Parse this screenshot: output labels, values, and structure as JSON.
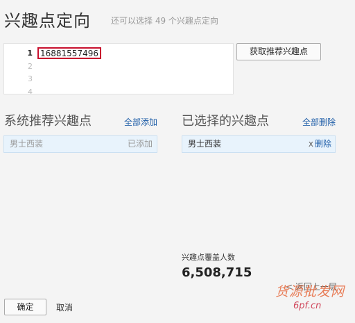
{
  "header": {
    "title": "兴趣点定向",
    "hint": "还可以选择 49 个兴趣点定向"
  },
  "editor": {
    "line_numbers": [
      "1",
      "2",
      "3",
      "4"
    ],
    "line1_value": "16881557496"
  },
  "toolbar": {
    "get_recommend_label": "获取推荐兴趣点"
  },
  "recommended": {
    "title": "系统推荐兴趣点",
    "add_all_label": "全部添加",
    "items": [
      {
        "label": "男士西装",
        "status": "已添加"
      }
    ]
  },
  "selected": {
    "title": "已选择的兴趣点",
    "remove_all_label": "全部删除",
    "items": [
      {
        "label": "男士西装",
        "remove_x": "x",
        "remove_label": "删除"
      }
    ]
  },
  "audience": {
    "label": "兴趣点覆盖人数",
    "value": "6,508,715"
  },
  "nav": {
    "back_label": "< 返回上一层"
  },
  "footer": {
    "confirm_label": "确定",
    "cancel_label": "取消"
  },
  "watermark": {
    "brand": "货源批发网",
    "url": "6pf.cn"
  },
  "colors": {
    "link": "#1f5ea8",
    "highlight_border": "#c8102e",
    "chip_bg": "#e8f3fc",
    "page_bg": "#f4f4f4"
  }
}
